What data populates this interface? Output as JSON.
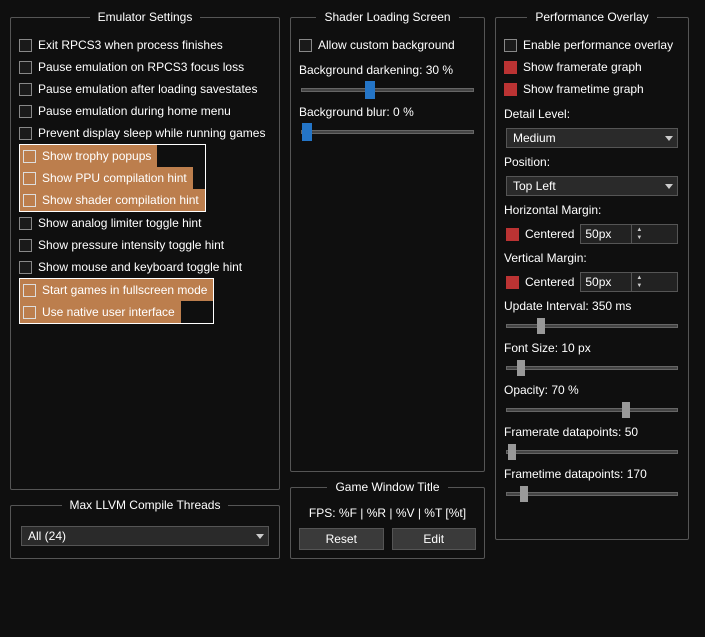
{
  "emulator": {
    "legend": "Emulator Settings",
    "items": [
      {
        "label": "Exit RPCS3 when process finishes"
      },
      {
        "label": "Pause emulation on RPCS3 focus loss"
      },
      {
        "label": "Pause emulation after loading savestates"
      },
      {
        "label": "Pause emulation during home menu"
      },
      {
        "label": "Prevent display sleep while running games"
      },
      {
        "label": "Show trophy popups",
        "hl": true,
        "group": 1
      },
      {
        "label": "Show PPU compilation hint",
        "hl": true,
        "group": 1
      },
      {
        "label": "Show shader compilation hint",
        "hl": true,
        "group": 1
      },
      {
        "label": "Show analog limiter toggle hint"
      },
      {
        "label": "Show pressure intensity toggle hint"
      },
      {
        "label": "Show mouse and keyboard toggle hint"
      },
      {
        "label": "Start games in fullscreen mode",
        "hl": true,
        "group": 2
      },
      {
        "label": "Use native user interface",
        "hl": true,
        "group": 2
      }
    ]
  },
  "llvm": {
    "legend": "Max LLVM Compile Threads",
    "value": "All (24)"
  },
  "shader": {
    "legend": "Shader Loading Screen",
    "allow": "Allow custom background",
    "darken": "Background darkening: 30 %",
    "darkenPos": 40,
    "blur": "Background blur: 0 %",
    "blurPos": 3
  },
  "gwt": {
    "legend": "Game Window Title",
    "value": "FPS: %F | %R | %V | %T [%t]",
    "reset": "Reset",
    "edit": "Edit"
  },
  "perf": {
    "legend": "Performance Overlay",
    "enable": "Enable performance overlay",
    "fr": "Show framerate graph",
    "ft": "Show frametime graph",
    "detail": "Detail Level:",
    "detailVal": "Medium",
    "pos": "Position:",
    "posVal": "Top Left",
    "hmargin": "Horizontal Margin:",
    "centeredH": "Centered",
    "hVal": "50px",
    "vmargin": "Vertical Margin:",
    "centeredV": "Centered",
    "vVal": "50px",
    "update": "Update Interval: 350 ms",
    "updatePos": 20,
    "font": "Font Size: 10 px",
    "fontPos": 8,
    "opacity": "Opacity: 70 %",
    "opacityPos": 70,
    "frdp": "Framerate datapoints: 50",
    "frdpPos": 3,
    "ftdp": "Frametime datapoints: 170",
    "ftdpPos": 10
  }
}
